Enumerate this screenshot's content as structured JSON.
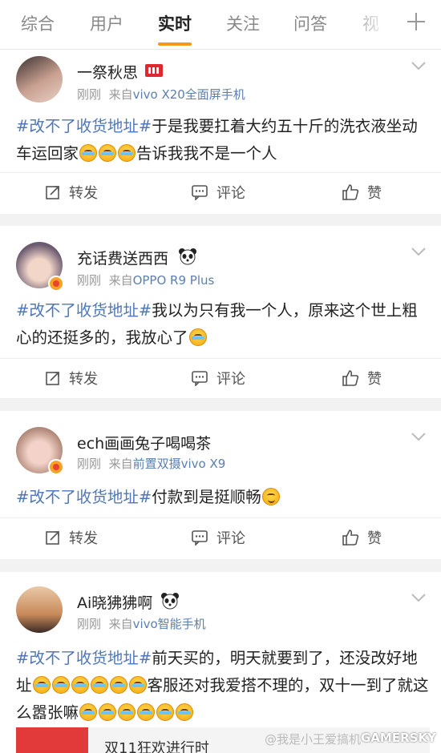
{
  "tabs": [
    "综合",
    "用户",
    "实时",
    "关注",
    "问答",
    "视"
  ],
  "tab_active": "实时",
  "action_labels": {
    "repost": "转发",
    "comment": "评论",
    "like": "赞"
  },
  "posts": [
    {
      "username": "一祭秋思",
      "time": "刚刚",
      "source_prefix": "来自",
      "source": "vivo X20全面屏手机",
      "hashtag": "#改不了收货地址#",
      "text": "于是我要扛着大约五十斤的洗衣液坐动车运回家",
      "text_after_emoji": "告诉我我不是一个人"
    },
    {
      "username": "充话费送西西",
      "time": "刚刚",
      "source_prefix": "来自",
      "source": "OPPO R9 Plus",
      "hashtag": "#改不了收货地址#",
      "text": "我以为只有我一个人，原来这个世上粗心的还挺多的，我放心了"
    },
    {
      "username": "ech画画兔子喝喝茶",
      "time": "刚刚",
      "source_prefix": "来自",
      "source": "前置双摄vivo X9",
      "hashtag": "#改不了收货地址#",
      "text": "付款到是挺顺畅"
    },
    {
      "username": "Ai晓狒狒啊",
      "time": "刚刚",
      "source_prefix": "来自",
      "source": "vivo智能手机",
      "hashtag": "#改不了收货地址#",
      "text": "前天买的，明天就要到了，还没改好地址",
      "text_mid": "客服还对我爱搭不理的，双十一到了就这么嚣张嘛"
    }
  ],
  "media_title": "双11狂欢进行时",
  "watermark": "@我是小王爱搞机",
  "watermark_brand": "GAMERSKY",
  "icons": {
    "tab_add": "plus-icon",
    "more": "chevron-down-icon",
    "repost": "repost-icon",
    "comment": "comment-icon",
    "like": "thumb-up-icon",
    "emoji_cry": "laugh-cry-emoji-icon",
    "emoji_smile": "smile-emoji-icon",
    "panda": "panda-emoji-icon"
  },
  "colors": {
    "accent": "#f29a18",
    "link": "#4f77b8",
    "source": "#5b7fb0"
  }
}
